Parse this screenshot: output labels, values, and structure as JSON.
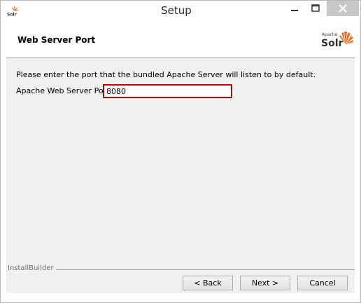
{
  "window": {
    "title": "Setup",
    "app_icon": "solr-app-icon"
  },
  "header": {
    "page_title": "Web Server Port",
    "logo": {
      "small_text": "Apache",
      "big_text": "Solr",
      "accent_color": "#e8712a"
    }
  },
  "form": {
    "intro": "Please enter the port that the bundled Apache Server will listen to by default.",
    "port_label": "Apache Web Server Port",
    "port_value": "8080"
  },
  "footer": {
    "brand": "InstallBuilder",
    "back_label": "< Back",
    "next_label": "Next >",
    "cancel_label": "Cancel"
  },
  "colors": {
    "input_focus_border": "#a01414",
    "close_button_bg": "#c7c7c7",
    "dialog_bg": "#f0f0f0"
  }
}
